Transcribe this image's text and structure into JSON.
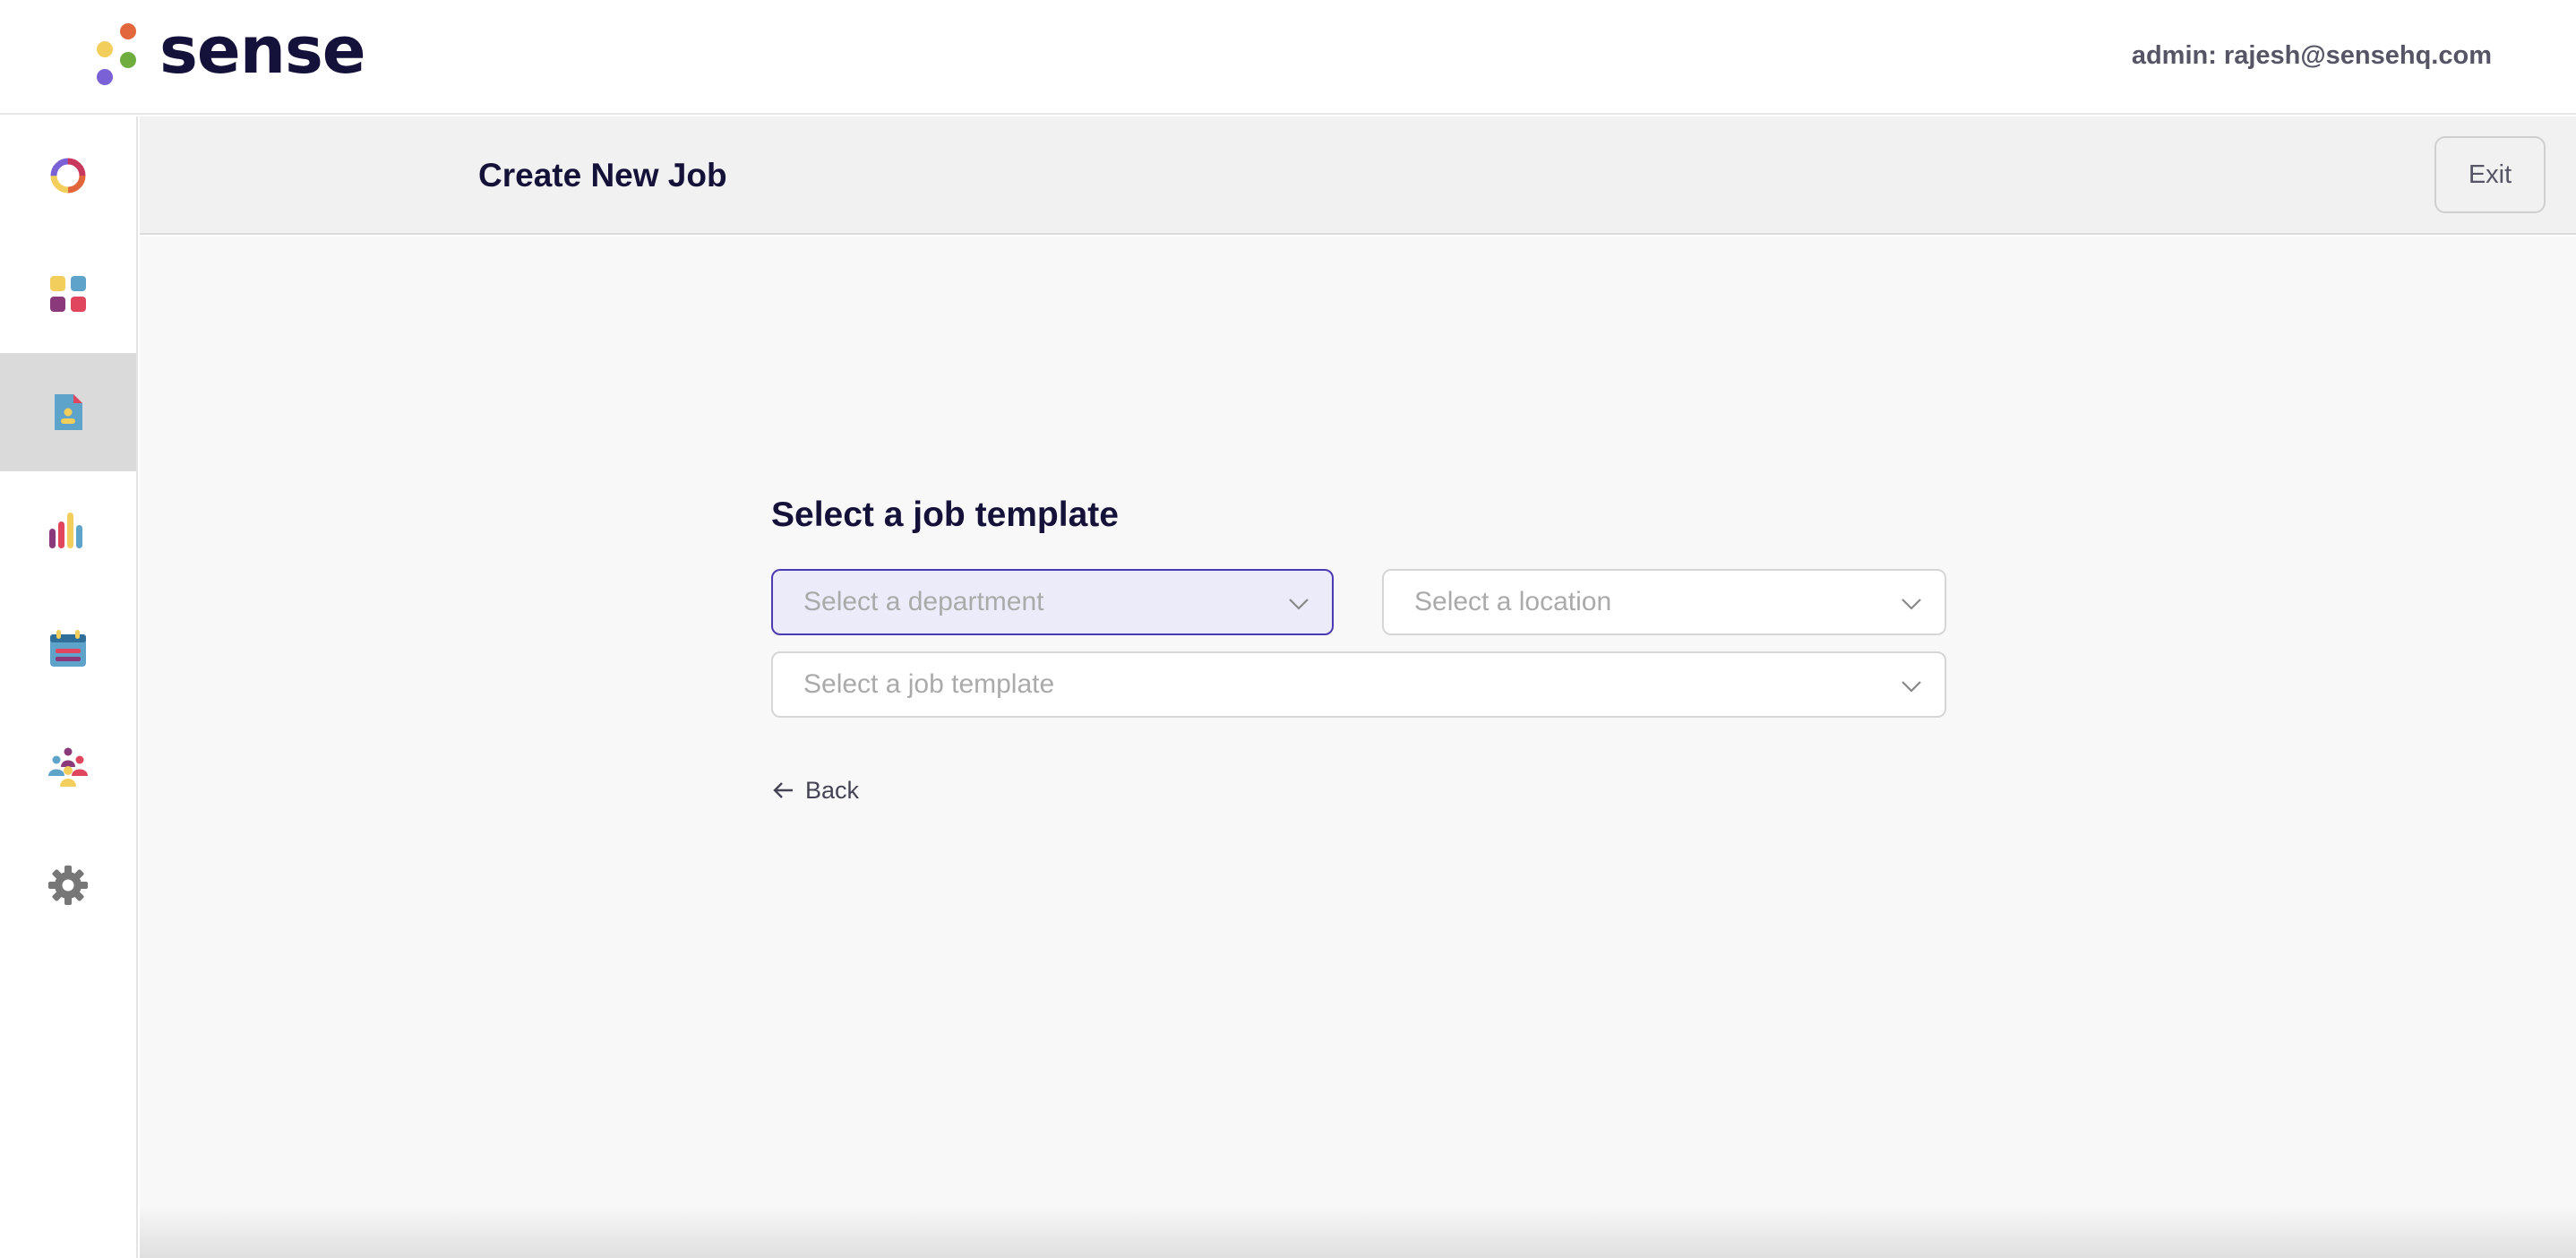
{
  "brand": {
    "name": "sense"
  },
  "header": {
    "admin_label": "admin: rajesh@sensehq.com"
  },
  "sidebar": {
    "items": [
      {
        "icon": "ring-logo-icon"
      },
      {
        "icon": "apps-grid-icon"
      },
      {
        "icon": "job-document-icon",
        "active": true
      },
      {
        "icon": "analytics-bars-icon"
      },
      {
        "icon": "calendar-icon"
      },
      {
        "icon": "people-group-icon"
      },
      {
        "icon": "gear-icon"
      }
    ]
  },
  "page": {
    "title": "Create New Job",
    "exit_label": "Exit"
  },
  "form": {
    "section_title": "Select a job template",
    "department_placeholder": "Select a department",
    "location_placeholder": "Select a location",
    "template_placeholder": "Select a job template",
    "back_label": "Back"
  },
  "colors": {
    "brand_navy": "#15123a",
    "focus_border": "#4a3bb0",
    "focus_fill": "#ecebfa",
    "active_nav": "#dadada"
  }
}
